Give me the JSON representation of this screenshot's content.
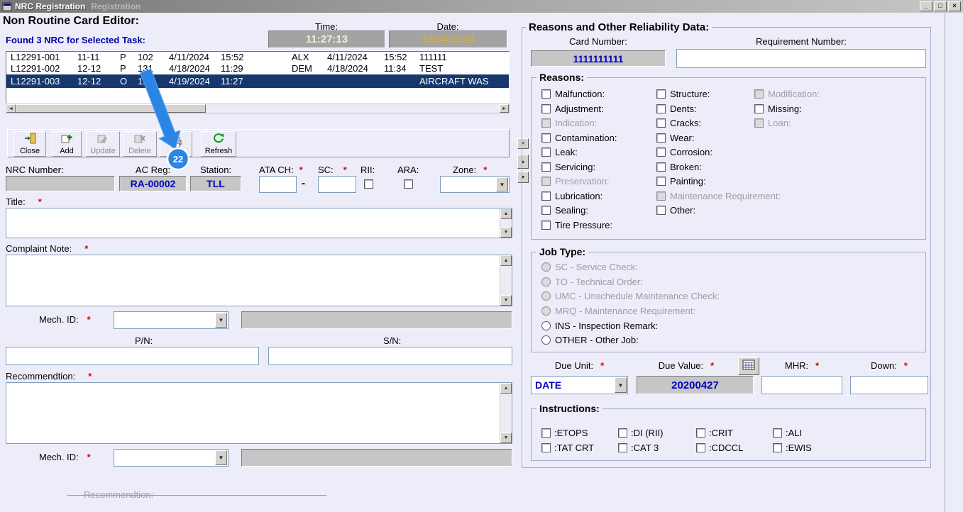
{
  "window": {
    "title": "NRC Registration",
    "ghost_title": "Registration",
    "minimize_glyph": "_",
    "maximize_glyph": "□",
    "close_glyph": "×"
  },
  "header": {
    "title": "Non Routine Card Editor:",
    "found": "Found 3 NRC for Selected Task:",
    "time_label": "Time:",
    "time_value": "11:27:13",
    "date_label": "Date:",
    "date_value": "19/04/2024"
  },
  "list": {
    "rows": [
      {
        "c": [
          "L12291-001",
          "11-11",
          "P",
          "102",
          "4/11/2024",
          "15:52",
          "ALX",
          "4/11/2024",
          "15:52",
          "111111"
        ],
        "selected": false
      },
      {
        "c": [
          "L12291-002",
          "12-12",
          "P",
          "131",
          "4/18/2024",
          "11:29",
          "DEM",
          "4/18/2024",
          "11:34",
          "TEST"
        ],
        "selected": false
      },
      {
        "c": [
          "L12291-003",
          "12-12",
          "O",
          "116",
          "4/19/2024",
          "11:27",
          "",
          "",
          "",
          "AIRCRAFT WAS"
        ],
        "selected": true
      }
    ]
  },
  "toolbar": {
    "close_label": "Close",
    "add_label": "Add",
    "update_label": "Update",
    "delete_label": "Delete",
    "refresh_label": "Refresh"
  },
  "annotation": {
    "badge": "22"
  },
  "form": {
    "required_mark": "*",
    "nrc_number_label": "NRC Number:",
    "ac_reg_label": "AC Reg:",
    "ac_reg_value": "RA-00002",
    "station_label": "Station:",
    "station_value": "TLL",
    "ata_ch_label": "ATA CH:",
    "dash": "-",
    "sc_label": "SC:",
    "rii_label": "RII:",
    "ara_label": "ARA:",
    "zone_label": "Zone:",
    "title_label": "Title:",
    "complaint_label": "Complaint Note:",
    "mech_id_label": "Mech. ID:",
    "pn_label": "P/N:",
    "sn_label": "S/N:",
    "recommendation_label": "Recommendtion:",
    "mech_id2_label": "Mech. ID:",
    "clipped_section_label": "Recommendtion:"
  },
  "reliability": {
    "title": "Reasons and Other Reliability Data:",
    "card_number_label": "Card Number:",
    "card_number_value": "1111111111",
    "requirement_label": "Requirement Number:",
    "reasons": {
      "title": "Reasons:",
      "col1": [
        {
          "label": "Malfunction:",
          "enabled": true
        },
        {
          "label": "Adjustment:",
          "enabled": true
        },
        {
          "label": "Indication:",
          "enabled": false
        },
        {
          "label": "Contamination:",
          "enabled": true
        },
        {
          "label": "Leak:",
          "enabled": true
        },
        {
          "label": "Servicing:",
          "enabled": true
        },
        {
          "label": "Preservation:",
          "enabled": false
        },
        {
          "label": "Lubrication:",
          "enabled": true
        },
        {
          "label": "Sealing:",
          "enabled": true
        },
        {
          "label": "Tire Pressure:",
          "enabled": true
        }
      ],
      "col2": [
        {
          "label": "Structure:",
          "enabled": true
        },
        {
          "label": "Dents:",
          "enabled": true
        },
        {
          "label": "Cracks:",
          "enabled": true
        },
        {
          "label": "Wear:",
          "enabled": true
        },
        {
          "label": "Corrosion:",
          "enabled": true
        },
        {
          "label": "Broken:",
          "enabled": true
        },
        {
          "label": "Painting:",
          "enabled": true
        },
        {
          "label": "Maintenance Requirement:",
          "enabled": false
        },
        {
          "label": "Other:",
          "enabled": true
        }
      ],
      "col3": [
        {
          "label": "Modification:",
          "enabled": false
        },
        {
          "label": "Missing:",
          "enabled": true
        },
        {
          "label": "Loan:",
          "enabled": false
        }
      ]
    },
    "job_type": {
      "title": "Job Type:",
      "options": [
        {
          "label": "SC - Service Check:",
          "enabled": false
        },
        {
          "label": "TO - Technical Order:",
          "enabled": false
        },
        {
          "label": "UMC - Unschedule Maintenance Check:",
          "enabled": false
        },
        {
          "label": "MRQ - Maintenance Requirement:",
          "enabled": false
        },
        {
          "label": "INS - Inspection Remark:",
          "enabled": true
        },
        {
          "label": "OTHER - Other Job:",
          "enabled": true
        }
      ]
    },
    "due": {
      "due_unit_label": "Due Unit:",
      "due_unit_value": "DATE",
      "due_value_label": "Due Value:",
      "due_value": "20200427",
      "mhr_label": "MHR:",
      "down_label": "Down:"
    },
    "instructions": {
      "title": "Instructions:",
      "row1": [
        ":ETOPS",
        ":DI (RII)",
        ":CRIT",
        ":ALI"
      ],
      "row2": [
        ":TAT CRT",
        ":CAT 3",
        ":CDCCL",
        ":EWIS"
      ]
    }
  }
}
